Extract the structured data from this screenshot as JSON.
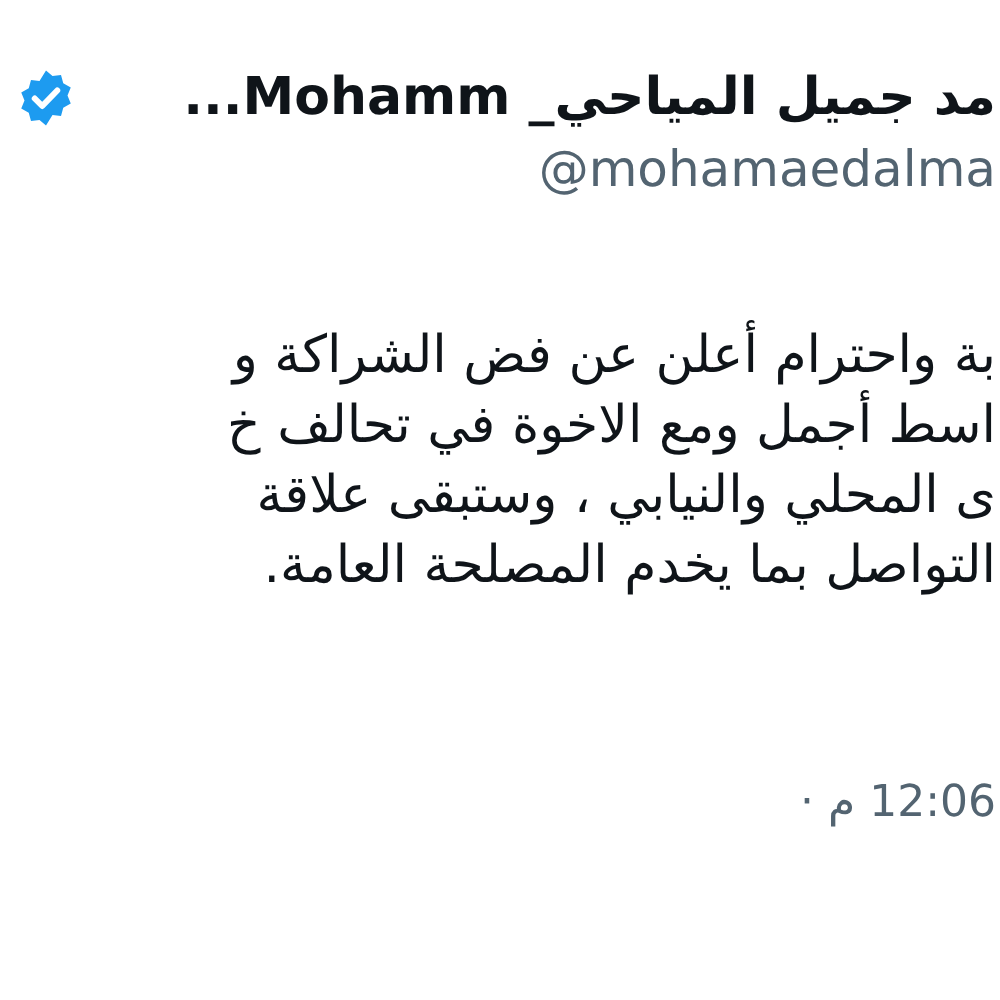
{
  "author": {
    "name": "مد جميل المياحي_ Mohamm...",
    "verified": true,
    "handle": "@mohamaedalma"
  },
  "tweet": {
    "lines": [
      "بة واحترام أعلن عن فض الشراكة و",
      "اسط أجمل ومع الاخوة في تحالف خ",
      "ى المحلي والنيابي ، وستبقى علاقة",
      "التواصل بما يخدم المصلحة العامة."
    ]
  },
  "timestamp": "12:06 م ·"
}
